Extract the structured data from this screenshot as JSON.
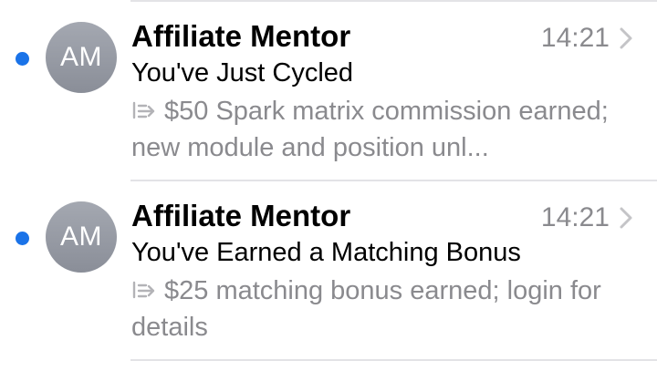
{
  "colors": {
    "unread_dot": "#1a73e8",
    "secondary_text": "#8a8a8e",
    "primary_text": "#000000",
    "separator": "#e3e3e6",
    "avatar": "#9a9ea7"
  },
  "messages": [
    {
      "avatar_initials": "AM",
      "sender": "Affiliate Mentor",
      "time": "14:21",
      "subject": "You've Just Cycled",
      "preview": "$50 Spark matrix commission earned; new module and position unl...",
      "unread": true,
      "icons": [
        "unread-dot",
        "reply-icon",
        "chevron-right-icon"
      ]
    },
    {
      "avatar_initials": "AM",
      "sender": "Affiliate Mentor",
      "time": "14:21",
      "subject": "You've Earned a Matching Bonus",
      "preview": "$25 matching bonus earned; login for details",
      "unread": true,
      "icons": [
        "unread-dot",
        "reply-icon",
        "chevron-right-icon"
      ]
    }
  ]
}
